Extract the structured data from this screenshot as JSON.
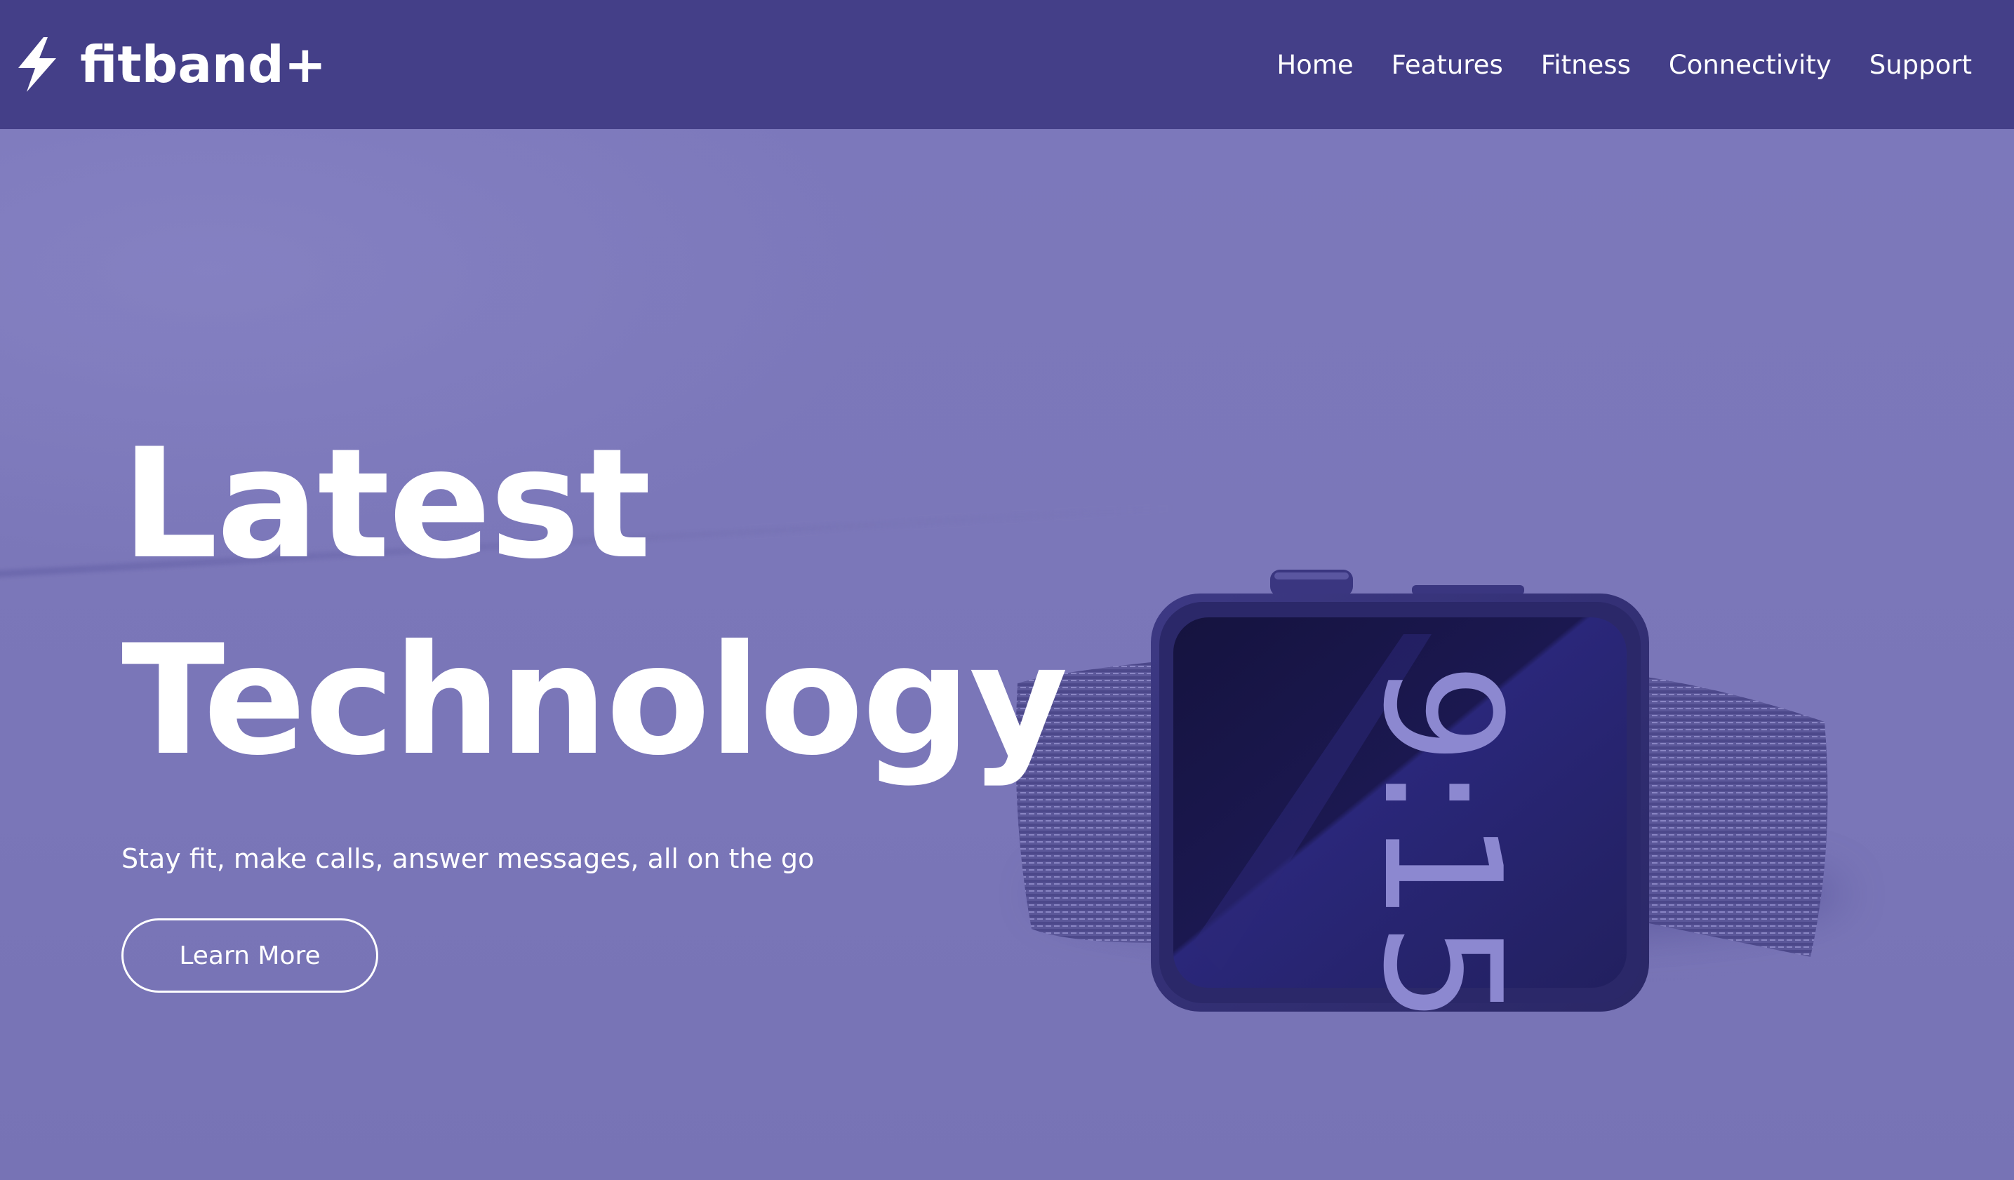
{
  "navbar": {
    "brand_name": "fitband+",
    "brand_icon": "lightning-bolt-icon",
    "links": [
      {
        "label": "Home"
      },
      {
        "label": "Features"
      },
      {
        "label": "Fitness"
      },
      {
        "label": "Connectivity"
      },
      {
        "label": "Support"
      }
    ]
  },
  "hero": {
    "title_line1": "Latest",
    "title_line2": "Technology",
    "subtitle": "Stay fit, make calls, answer messages, all on the go",
    "cta_label": "Learn More",
    "watch_time": "9:15"
  },
  "colors": {
    "navbar_bg": "#443f88",
    "hero_overlay": "#7e7abc",
    "text": "#ffffff",
    "watch_screen": "#1d1a52"
  }
}
